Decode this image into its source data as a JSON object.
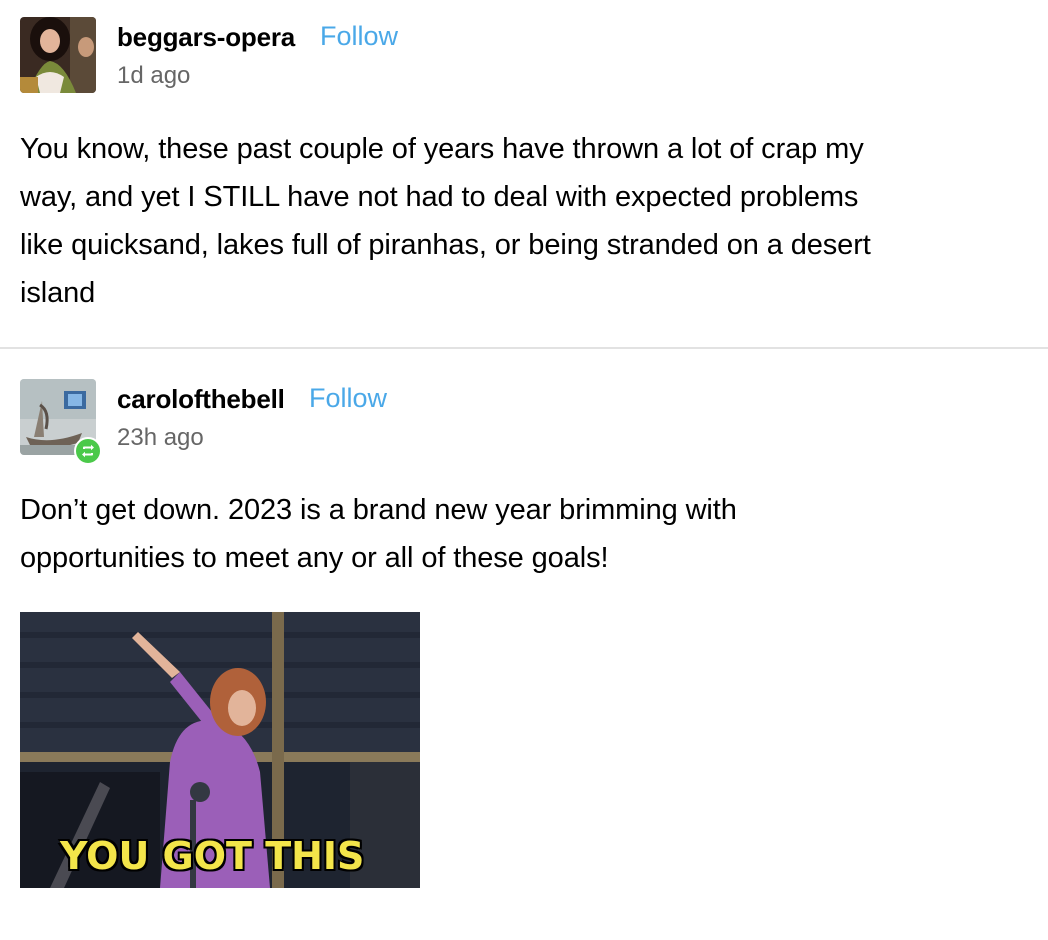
{
  "posts": [
    {
      "username": "beggars-opera",
      "follow_label": "Follow",
      "time": "1d ago",
      "body_lines": [
        "You know, these past couple of years have thrown a lot of crap my",
        "way, and yet I STILL have not had to deal with expected problems",
        "like quicksand, lakes full of piranhas, or being stranded on a desert",
        "island"
      ]
    },
    {
      "username": "carolofthebell",
      "follow_label": "Follow",
      "time": "23h ago",
      "reblog_icon": "reblog-icon",
      "body_lines": [
        "Don’t get down. 2023 is a brand new year brimming with",
        "opportunities to meet any or all of these goals!"
      ],
      "gif_caption": "YOU GOT THIS"
    }
  ],
  "colors": {
    "follow": "#4aa8e8",
    "reblog_badge": "#4bc94a",
    "gif_caption": "#f3e54a"
  }
}
